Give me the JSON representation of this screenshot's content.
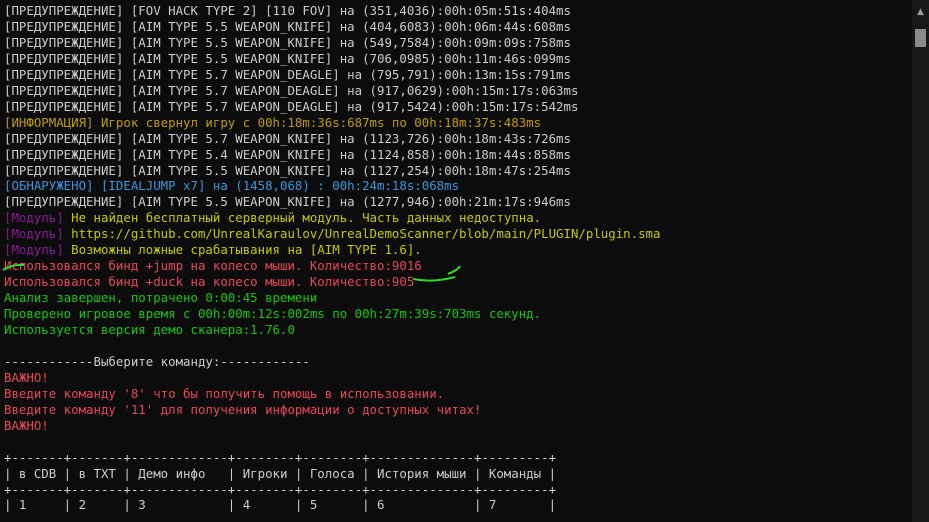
{
  "console": {
    "lines": [
      {
        "text": "[ПРЕДУПРЕЖДЕНИЕ] [FOV HACK TYPE 2] [110 FOV] на (351,4036):00h:05m:51s:404ms",
        "color": "white"
      },
      {
        "text": "[ПРЕДУПРЕЖДЕНИЕ] [AIM TYPE 5.5 WEAPON_KNIFE] на (404,6083):00h:06m:44s:608ms",
        "color": "white"
      },
      {
        "text": "[ПРЕДУПРЕЖДЕНИЕ] [AIM TYPE 5.5 WEAPON_KNIFE] на (549,7584):00h:09m:09s:758ms",
        "color": "white"
      },
      {
        "text": "[ПРЕДУПРЕЖДЕНИЕ] [AIM TYPE 5.5 WEAPON_KNIFE] на (706,0985):00h:11m:46s:099ms",
        "color": "white"
      },
      {
        "text": "[ПРЕДУПРЕЖДЕНИЕ] [AIM TYPE 5.7 WEAPON_DEAGLE] на (795,791):00h:13m:15s:791ms",
        "color": "white"
      },
      {
        "text": "[ПРЕДУПРЕЖДЕНИЕ] [AIM TYPE 5.7 WEAPON_DEAGLE] на (917,0629):00h:15m:17s:063ms",
        "color": "white"
      },
      {
        "text": "[ПРЕДУПРЕЖДЕНИЕ] [AIM TYPE 5.7 WEAPON_DEAGLE] на (917,5424):00h:15m:17s:542ms",
        "color": "white"
      },
      {
        "text": "[ИНФОРМАЦИЯ] Игрок свернул игру с 00h:18m:36s:687ms по 00h:18m:37s:483ms",
        "color": "orange"
      },
      {
        "text": "[ПРЕДУПРЕЖДЕНИЕ] [AIM TYPE 5.7 WEAPON_KNIFE] на (1123,726):00h:18m:43s:726ms",
        "color": "white"
      },
      {
        "text": "[ПРЕДУПРЕЖДЕНИЕ] [AIM TYPE 5.4 WEAPON_KNIFE] на (1124,858):00h:18m:44s:858ms",
        "color": "white"
      },
      {
        "text": "[ПРЕДУПРЕЖДЕНИЕ] [AIM TYPE 5.5 WEAPON_KNIFE] на (1127,254):00h:18m:47s:254ms",
        "color": "white"
      },
      {
        "text": "[ОБНАРУЖЕНО] [IDEALJUMP x7] на (1458,068) : 00h:24m:18s:068ms",
        "color": "cyan"
      },
      {
        "text": "[ПРЕДУПРЕЖДЕНИЕ] [AIM TYPE 5.5 WEAPON_KNIFE] на (1277,946):00h:21m:17s:946ms",
        "color": "white"
      },
      {
        "prefix": "[Модуль]",
        "text": " Не найден бесплатный серверный модуль. Часть данных недоступна.",
        "color": "yellow"
      },
      {
        "prefix": "[Модуль]",
        "text": " https://github.com/UnrealKaraulov/UnrealDemoScanner/blob/main/PLUGIN/plugin.sma",
        "color": "yellow"
      },
      {
        "prefix": "[Модуль]",
        "text": " Возможны ложные срабатывания на [AIM TYPE 1.6].",
        "color": "yellow"
      },
      {
        "text": "Использовался бинд +jump на колесо мыши. Количество:9016",
        "color": "red"
      },
      {
        "text": "Использовался бинд +duck на колесо мыши. Количество:905",
        "color": "red"
      },
      {
        "text": "Анализ завершен, потрачено 0:00:45 времени",
        "color": "green"
      },
      {
        "text": "Проверено игровое время с 00h:00m:12s:002ms по 00h:27m:39s:703ms секунд.",
        "color": "green"
      },
      {
        "text": "Используется версия демо сканера:1.76.0",
        "color": "green"
      },
      {
        "text": "",
        "color": "white"
      },
      {
        "text": "------------Выберите команду:------------",
        "color": "white"
      },
      {
        "text": "ВАЖНО!",
        "color": "red"
      },
      {
        "text": "Введите команду '8' что бы получить помощь в использовании.",
        "color": "red"
      },
      {
        "text": "Введите команду '11' для получения информации о доступных читах!",
        "color": "red"
      },
      {
        "text": "ВАЖНО!",
        "color": "red"
      },
      {
        "text": "",
        "color": "white"
      },
      {
        "text": "+-------+-------+-------------+--------+--------+--------------+---------+",
        "color": "white"
      },
      {
        "text": "| в CDB | в TXT | Демо инфо   | Игроки | Голоса | История мыши | Команды |",
        "color": "white"
      },
      {
        "text": "+-------+-------+-------------+--------+--------+--------------+---------+",
        "color": "white"
      },
      {
        "text": "| 1     | 2     | 3           | 4      | 5      | 6            | 7       |",
        "color": "white"
      }
    ]
  },
  "colors": {
    "white": "#cccccc",
    "orange": "#c19c00",
    "cyan": "#3a96dd",
    "magenta": "#881798",
    "yellow": "#c8c800",
    "red": "#e74856",
    "green": "#16c60c",
    "annotation": "#2fd82f",
    "background": "#0c0c0c"
  },
  "scrollbar": {
    "up_icon": "triangle-up-icon"
  }
}
